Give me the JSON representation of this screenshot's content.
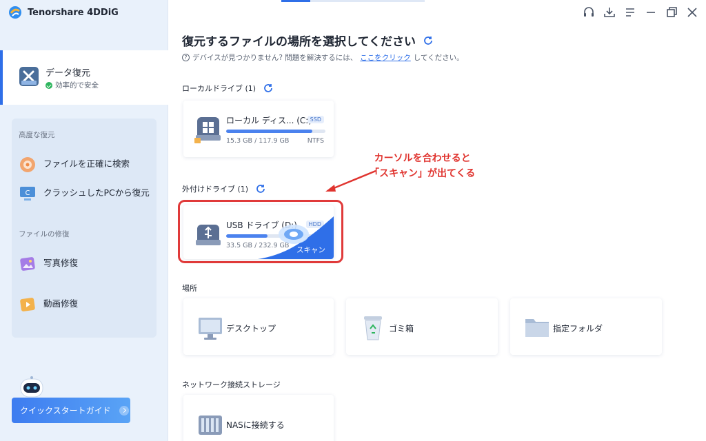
{
  "app": {
    "name": "Tenorshare 4DDiG"
  },
  "sidebar": {
    "active": {
      "title": "データ復元",
      "subtitle": "効率的で安全"
    },
    "sections": [
      {
        "label": "高度な復元"
      },
      {
        "label": "ファイルの修復"
      }
    ],
    "items": [
      {
        "label": "ファイルを正確に検索",
        "icon": "target-search-icon"
      },
      {
        "label": "クラッシュしたPCから復元",
        "icon": "crashed-pc-icon"
      },
      {
        "label": "写真修復",
        "icon": "photo-repair-icon"
      },
      {
        "label": "動画修復",
        "icon": "video-repair-icon"
      }
    ],
    "quick_start": "クイックスタートガイド"
  },
  "window_controls": [
    "headset-icon",
    "download-icon",
    "menu-icon",
    "minimize-icon",
    "restore-icon",
    "close-icon"
  ],
  "main": {
    "heading": "復元するファイルの場所を選択してください",
    "hint": {
      "prefix": "デバイスが見つかりません? 問題を解決するには、",
      "link": "ここをクリック",
      "suffix": "してください。"
    },
    "local": {
      "label": "ローカルドライブ (1)",
      "drive": {
        "name": "ローカル ディス... (C:)",
        "tag": "SSD",
        "size": "15.3 GB / 117.9 GB",
        "fs": "NTFS",
        "used_fraction": 0.87
      }
    },
    "external": {
      "label": "外付けドライブ (1)",
      "drive": {
        "name": "USB ドライブ (D:)",
        "tag": "HDD",
        "size": "33.5 GB / 232.9 GB",
        "used_fraction": 0.42,
        "scan": "スキャン"
      }
    },
    "locations": {
      "label": "場所",
      "items": [
        {
          "label": "デスクトップ",
          "icon": "desktop-icon"
        },
        {
          "label": "ゴミ箱",
          "icon": "recycle-bin-icon"
        },
        {
          "label": "指定フォルダ",
          "icon": "folder-icon"
        }
      ]
    },
    "network": {
      "label": "ネットワーク接続ストレージ",
      "item": {
        "label": "NASに接続する",
        "icon": "nas-icon"
      }
    }
  },
  "annotation": {
    "line1": "カーソルを合わせると",
    "line2": "「スキャン」が出てくる"
  },
  "colors": {
    "accent": "#2f6fe8",
    "annotation": "#e0342f",
    "sidebar_bg": "#e9f1fb"
  }
}
